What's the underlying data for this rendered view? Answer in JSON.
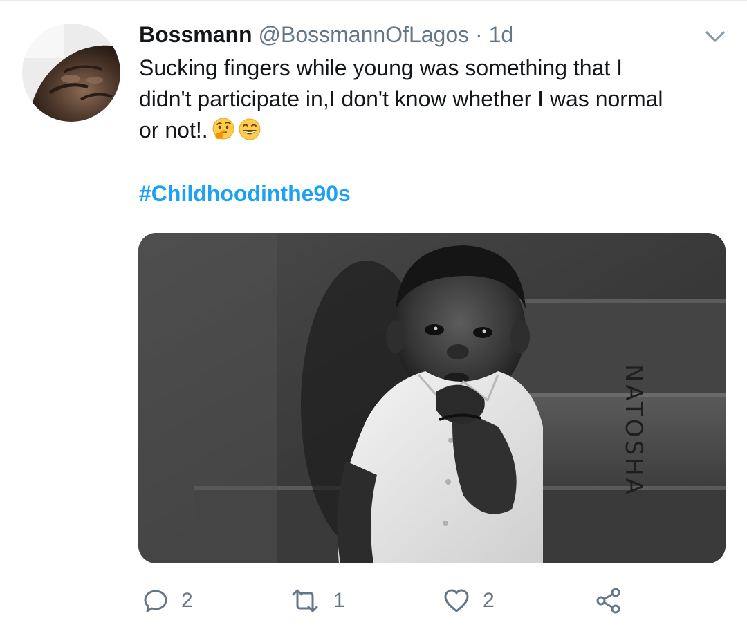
{
  "tweet": {
    "display_name": "Bossmann",
    "handle": "@BossmannOfLagos",
    "separator": "·",
    "time": "1d",
    "text_line1": "Sucking fingers while young was something that I",
    "text_line2": "didn't participate in,I don't know whether I was normal",
    "text_line3": "or not!.",
    "emojis": [
      "thinking-face",
      "grinning-squinting-face"
    ],
    "hashtag": "#Childhoodinthe90s",
    "image_watermark": "NATOSHA"
  },
  "actions": {
    "reply_count": "2",
    "retweet_count": "1",
    "like_count": "2"
  },
  "colors": {
    "text": "#14171a",
    "secondary": "#657786",
    "link": "#1da1f2"
  },
  "icons": [
    "chevron-down-icon",
    "reply-icon",
    "retweet-icon",
    "heart-icon",
    "share-icon"
  ]
}
